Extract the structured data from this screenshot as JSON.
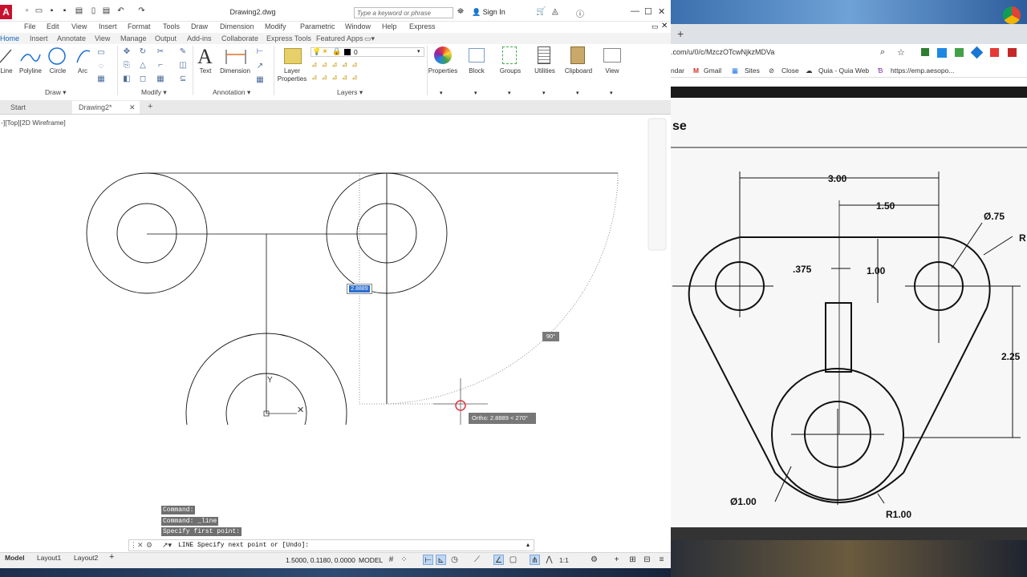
{
  "autocad": {
    "title": "Drawing2.dwg",
    "search_placeholder": "Type a keyword or phrase",
    "sign_in": "Sign In",
    "menus": [
      "File",
      "Edit",
      "View",
      "Insert",
      "Format",
      "Tools",
      "Draw",
      "Dimension",
      "Modify",
      "Parametric",
      "Window",
      "Help",
      "Express"
    ],
    "ribbon_tabs": [
      "Home",
      "Insert",
      "Annotate",
      "View",
      "Manage",
      "Output",
      "Add-ins",
      "Collaborate",
      "Express Tools",
      "Featured Apps"
    ],
    "draw_tools": [
      "Line",
      "Polyline",
      "Circle",
      "Arc"
    ],
    "annotation_tools": [
      "Text",
      "Dimension"
    ],
    "layer_props": "Layer\nProperties",
    "layer_name": "0",
    "big_tools": [
      "Properties",
      "Block",
      "Groups",
      "Utilities",
      "Clipboard",
      "View"
    ],
    "panels": {
      "draw": "Draw",
      "modify": "Modify",
      "annotation": "Annotation",
      "layers": "Layers"
    },
    "file_tabs": {
      "start": "Start",
      "drawing": "Drawing2*"
    },
    "view_label": "-][Top][2D Wireframe]",
    "dynamic_input_value": "2.8889",
    "angle_badge": "90°",
    "ortho_tooltip": "Ortho: 2.8889 < 270°",
    "command_history": [
      "Command:",
      "Command: _line",
      "Specify first point:"
    ],
    "command_prompt": "LINE Specify next point or [Undo]:",
    "layout_tabs": [
      "Model",
      "Layout1",
      "Layout2"
    ],
    "coordinates": "1.5000, 0.1180, 0.0000",
    "model_label": "MODEL",
    "scale": "1:1"
  },
  "browser": {
    "url": ".com/u/0/c/MzczOTcwNjkzMDVa",
    "bookmarks": [
      "ndar",
      "Gmail",
      "Sites",
      "Close",
      "Quia - Quia Web",
      "https://emp.aesopo..."
    ],
    "doc_heading": "se",
    "dimensions": {
      "d300": "3.00",
      "d150": "1.50",
      "d075": "Ø.75",
      "rtop": "R",
      "d375": ".375",
      "d100": "1.00",
      "d225": "2.25",
      "dia100": "Ø1.00",
      "r100": "R1.00"
    }
  },
  "colors": {
    "accent": "#1565c0",
    "autocad_red": "#c8102e",
    "cursor": "#d9363e"
  }
}
